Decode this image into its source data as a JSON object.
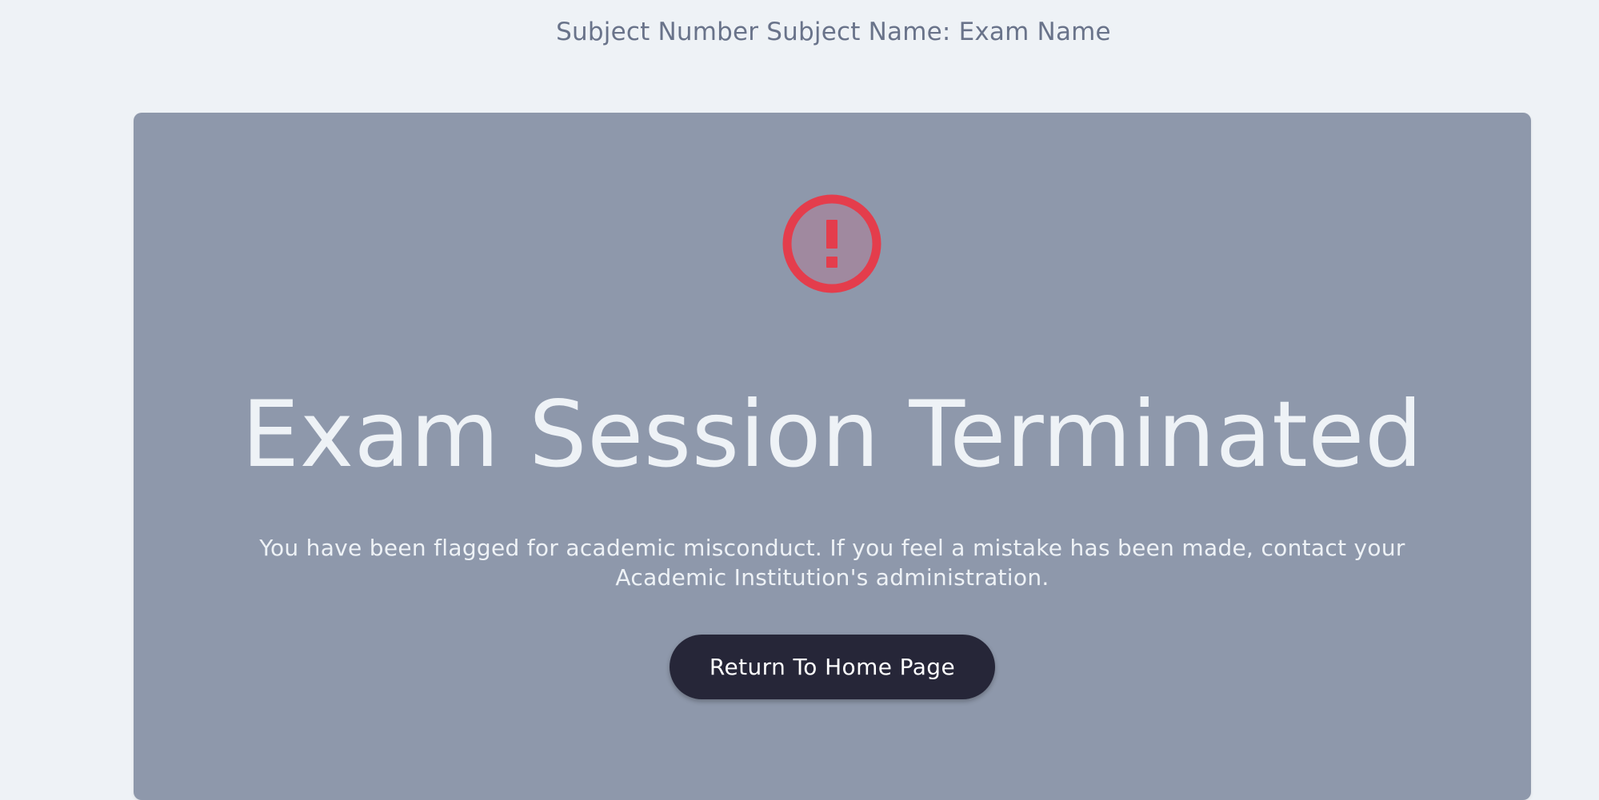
{
  "header": {
    "exam_title": "Subject Number Subject Name: Exam Name"
  },
  "panel": {
    "status_icon": "exclamation-circle-icon",
    "title": "Exam Session Terminated",
    "message": "You have been flagged for academic misconduct. If you feel a mistake has been made, contact your Academic Institution's administration.",
    "return_button_label": "Return To Home Page"
  },
  "colors": {
    "page_background": "#eef2f6",
    "panel_background": "#8e98ab",
    "alert_red": "#e43d4c",
    "button_background": "#262638",
    "text_light": "#eef2f6",
    "header_text": "#69738a"
  }
}
